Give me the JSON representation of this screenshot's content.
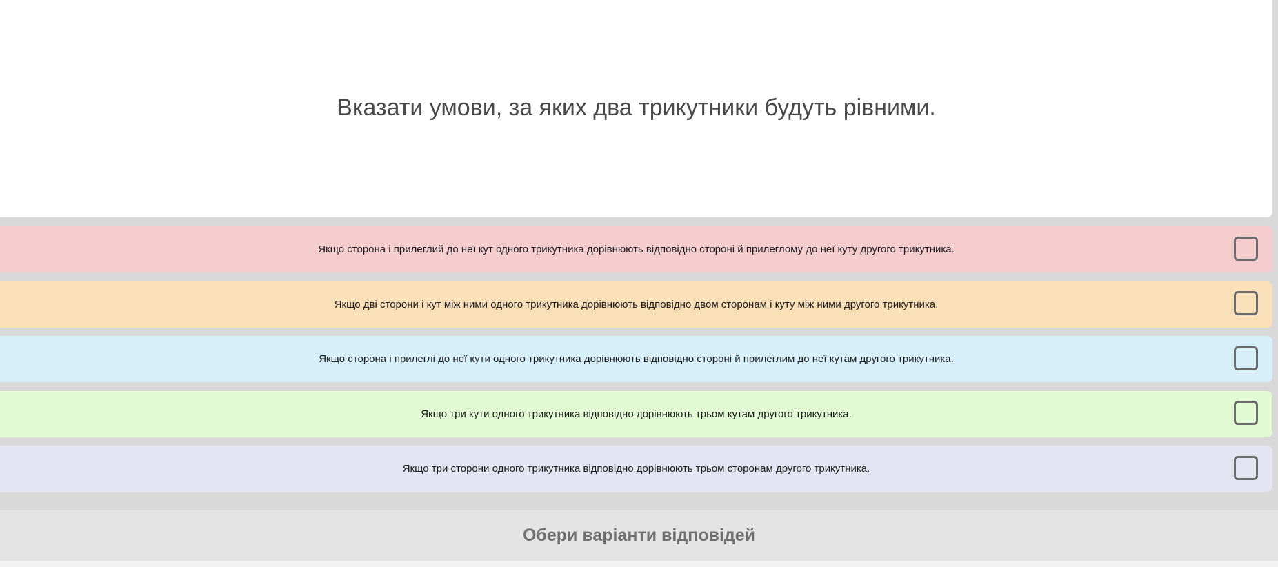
{
  "question": {
    "text": "Вказати умови, за яких два трикутники будуть рівними."
  },
  "options": [
    {
      "label": "Якщо сторона і прилеглий до неї кут одного трикутника дорівнюють відповідно стороні й прилеглому до неї куту другого трикутника.",
      "color": "#f5cdcf",
      "checked": false
    },
    {
      "label": "Якщо дві сторони і кут між ними одного трикутника дорівнюють відповідно двом сторонам і куту між ними другого трикутника.",
      "color": "#fae0b9",
      "checked": false
    },
    {
      "label": "Якщо сторона і прилеглі до неї кути одного трикутника дорівнюють відповідно стороні й прилеглим до неї кутам другого трикутника.",
      "color": "#d6eff9",
      "checked": false
    },
    {
      "label": "Якщо три кути одного трикутника відповідно дорівнюють трьом кутам другого трикутника.",
      "color": "#e1fad3",
      "checked": false
    },
    {
      "label": "Якщо три сторони одного трикутника відповідно дорівнюють трьом сторонам другого трикутника.",
      "color": "#e5e4f2",
      "checked": false
    }
  ],
  "footer": {
    "prompt": "Обери варіанти відповідей"
  }
}
